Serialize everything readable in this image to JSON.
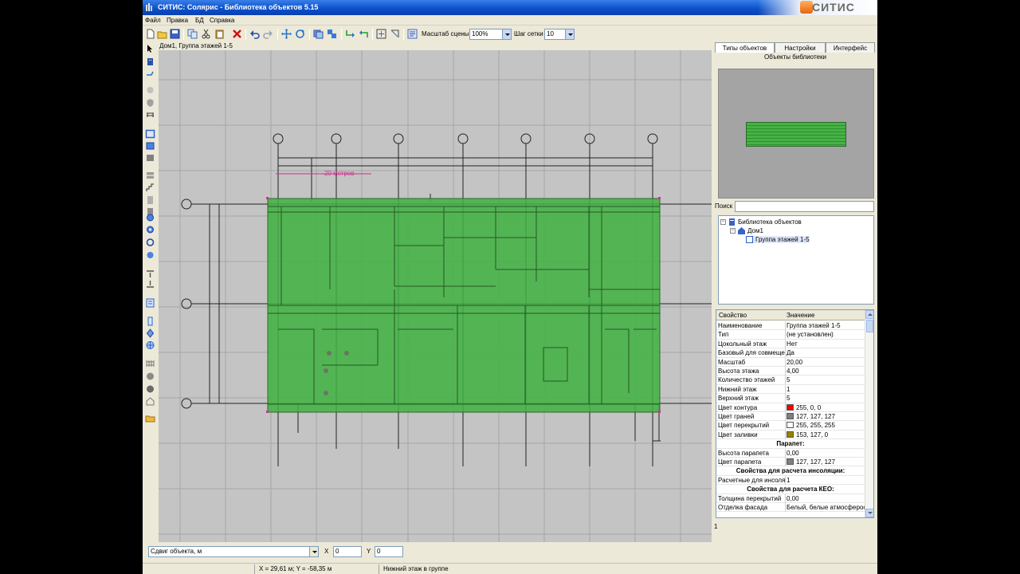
{
  "app": {
    "title": "СИТИС: Солярис - Библиотека объектов 5.15",
    "logo_text": "СИТИС"
  },
  "menu": [
    "Файл",
    "Правка",
    "БД",
    "Справка"
  ],
  "toolbar": {
    "scale_label": "Масштаб сцены",
    "scale_value": "100%",
    "grid_label": "Шаг сетки",
    "grid_value": "10"
  },
  "canvas": {
    "breadcrumb": "Дом1, Группа этажей 1-5",
    "dimension_label": "20 метров"
  },
  "right_panel": {
    "tabs": [
      "Типы объектов",
      "Настройки",
      "Интерфейс"
    ],
    "library_title": "Объекты библиотеки",
    "search_label": "Поиск",
    "search_value": "",
    "tree": {
      "root": "Библиотека объектов",
      "house": "Дом1",
      "group": "Группа этажей 1-5"
    },
    "props_header": {
      "key": "Свойство",
      "value": "Значение"
    },
    "properties": [
      {
        "key": "Наименование",
        "value": "Группа этажей 1-5"
      },
      {
        "key": "Тип",
        "value": "(не установлен)"
      },
      {
        "key": "Цокольный этаж",
        "value": "Нет"
      },
      {
        "key": "Базовый для совмеще",
        "value": "Да"
      },
      {
        "key": "Масштаб",
        "value": "20,00"
      },
      {
        "key": "Высота этажа",
        "value": "4,00"
      },
      {
        "key": "Количество этажей",
        "value": "5"
      },
      {
        "key": "Нижний этаж",
        "value": "1"
      },
      {
        "key": "Верхний этаж",
        "value": "5"
      },
      {
        "key": "Цвет контура",
        "value": "255, 0, 0",
        "color": "#ff0000"
      },
      {
        "key": "Цвет граней",
        "value": "127, 127, 127",
        "color": "#7f7f7f"
      },
      {
        "key": "Цвет перекрытий",
        "value": "255, 255, 255",
        "color": "#ffffff"
      },
      {
        "key": "Цвет заливки",
        "value": "153, 127, 0",
        "color": "#997f00"
      },
      {
        "section": "Парапет:"
      },
      {
        "key": "Высота парапета",
        "value": "0,00"
      },
      {
        "key": "Цвет парапета",
        "value": "127, 127, 127",
        "color": "#7f7f7f"
      },
      {
        "section": "Свойства для расчета инсоляции:"
      },
      {
        "key": "Расчетные для инсоля",
        "value": "1"
      },
      {
        "section": "Свойства для расчета КЕО:"
      },
      {
        "key": "Толщина перекрытий",
        "value": "0,00"
      },
      {
        "key": "Отделка фасада",
        "value": "Белый, белые атмосферос"
      }
    ],
    "status": "1"
  },
  "bottom": {
    "mode_value": "Сдвиг объекта, м",
    "x_label": "X",
    "x_value": "0",
    "y_label": "Y",
    "y_value": "0"
  },
  "status_bar": {
    "coords": "X = 29,61 м; Y = -58,35 м",
    "message": "Нижний этаж в группе"
  },
  "colors": {
    "selection_fill": "#3fb23f",
    "grid_bg": "#c4c4c4",
    "dimension_color": "#d03090"
  }
}
